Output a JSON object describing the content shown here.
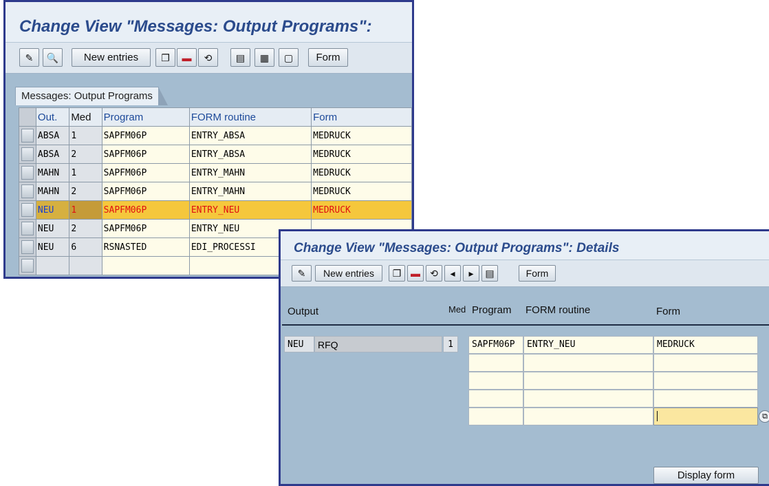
{
  "list_window": {
    "title": "Change View \"Messages: Output Programs\":",
    "toolbar": {
      "new_entries_label": "New entries",
      "form_label": "Form",
      "icons": [
        "display-change-icon",
        "select-view-icon",
        "copy-icon",
        "delete-icon",
        "undo-icon",
        "select-all-icon",
        "select-block-icon",
        "deselect-all-icon"
      ]
    },
    "tab_label": "Messages: Output Programs",
    "columns": [
      "Out.",
      "Med",
      "Program",
      "FORM routine",
      "Form"
    ],
    "rows": [
      {
        "out": "ABSA",
        "med": "1",
        "program": "SAPFM06P",
        "routine": "ENTRY_ABSA",
        "form": "MEDRUCK"
      },
      {
        "out": "ABSA",
        "med": "2",
        "program": "SAPFM06P",
        "routine": "ENTRY_ABSA",
        "form": "MEDRUCK"
      },
      {
        "out": "MAHN",
        "med": "1",
        "program": "SAPFM06P",
        "routine": "ENTRY_MAHN",
        "form": "MEDRUCK"
      },
      {
        "out": "MAHN",
        "med": "2",
        "program": "SAPFM06P",
        "routine": "ENTRY_MAHN",
        "form": "MEDRUCK"
      },
      {
        "out": "NEU",
        "med": "1",
        "program": "SAPFM06P",
        "routine": "ENTRY_NEU",
        "form": "MEDRUCK"
      },
      {
        "out": "NEU",
        "med": "2",
        "program": "SAPFM06P",
        "routine": "ENTRY_NEU",
        "form": ""
      },
      {
        "out": "NEU",
        "med": "6",
        "program": "RSNASTED",
        "routine": "EDI_PROCESSI",
        "form": ""
      }
    ],
    "highlighted_row": 4
  },
  "detail_window": {
    "title": "Change View \"Messages: Output Programs\": Details",
    "toolbar": {
      "new_entries_label": "New entries",
      "form_label": "Form",
      "icons": [
        "display-change-icon",
        "copy-icon",
        "delete-icon",
        "undo-icon",
        "previous-entry-icon",
        "next-entry-icon",
        "other-entry-icon"
      ]
    },
    "headers": {
      "output": "Output",
      "med": "Med",
      "program": "Program",
      "form_routine": "FORM routine",
      "form": "Form"
    },
    "output_code": "NEU",
    "output_desc": "RFQ",
    "med_value": "1",
    "entry": {
      "program": "SAPFM06P",
      "routine": "ENTRY_NEU",
      "form": "MEDRUCK"
    },
    "display_form_label": "Display form"
  },
  "colors": {
    "window_border": "#2e3a8c",
    "title_text": "#2b4b8c",
    "highlight_row": "#f5c73c",
    "highlight_text": "#e01010",
    "panel_bg": "#a4bcd0"
  }
}
